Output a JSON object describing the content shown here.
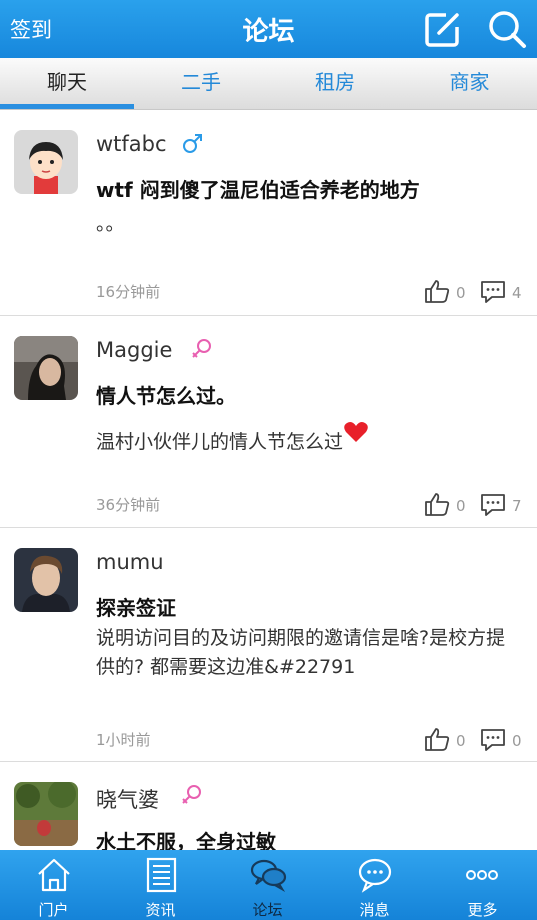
{
  "header": {
    "checkin_label": "签到",
    "title": "论坛",
    "compose_icon": "compose-icon",
    "search_icon": "search-icon"
  },
  "tabs": [
    {
      "label": "聊天",
      "active": true
    },
    {
      "label": "二手",
      "active": false
    },
    {
      "label": "租房",
      "active": false
    },
    {
      "label": "商家",
      "active": false
    }
  ],
  "posts": [
    {
      "username": "wtfabc",
      "gender": "male",
      "title": "wtf 闷到傻了温尼伯适合养老的地方",
      "body": "。。",
      "time": "16分钟前",
      "likes": "0",
      "comments": "4"
    },
    {
      "username": "Maggie",
      "gender": "female",
      "title": "情人节怎么过。",
      "body": "温村小伙伴儿的情人节怎么过",
      "time": "36分钟前",
      "likes": "0",
      "comments": "7"
    },
    {
      "username": "mumu",
      "gender": "",
      "title": "探亲签证",
      "body": "说明访问目的及访问期限的邀请信是啥?是校方提供的? 都需要这边准&#22791",
      "time": "1小时前",
      "likes": "0",
      "comments": "0"
    },
    {
      "username": "晓气婆",
      "gender": "female",
      "title": "水土不服，全身过敏",
      "body": "",
      "time": "",
      "likes": "",
      "comments": ""
    }
  ],
  "bottom_nav": [
    {
      "label": "门户",
      "icon": "home-icon",
      "active": false
    },
    {
      "label": "资讯",
      "icon": "news-icon",
      "active": false
    },
    {
      "label": "论坛",
      "icon": "forum-icon",
      "active": true
    },
    {
      "label": "消息",
      "icon": "message-icon",
      "active": false
    },
    {
      "label": "更多",
      "icon": "more-icon",
      "active": false
    }
  ],
  "colors": {
    "header_blue": "#1e90e0",
    "tab_blue": "#2489d8",
    "male_blue": "#2a9be8",
    "female_pink": "#e85fb0"
  }
}
